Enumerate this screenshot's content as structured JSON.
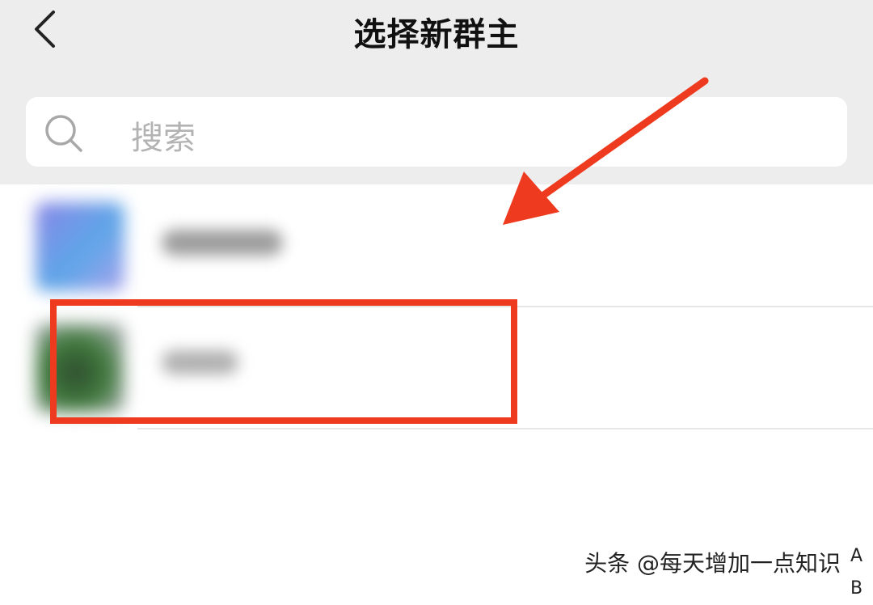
{
  "header": {
    "title": "选择新群主",
    "back_icon": "chevron-left-icon"
  },
  "search": {
    "placeholder": "搜索",
    "icon": "search-icon"
  },
  "contacts": [
    {
      "name": "",
      "blurred": true,
      "avatar_color": "#7c95e6"
    },
    {
      "name": "",
      "blurred": true,
      "avatar_color": "#3f6e3c",
      "highlighted": true
    }
  ],
  "annotations": {
    "highlight_color": "#ee3a1e",
    "arrow_color": "#ee3a1e"
  },
  "watermark": "头条 @每天增加一点知识",
  "alpha_index": [
    "A",
    "B"
  ]
}
